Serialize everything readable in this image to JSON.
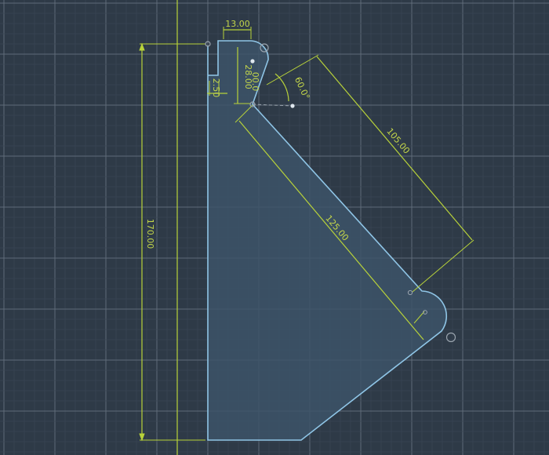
{
  "colors": {
    "background": "#2e3a47",
    "grid_minor": "#3a4654",
    "grid_major": "#5f6b78",
    "sketch_line": "#8fc5e6",
    "sketch_fill": "#3c5468",
    "dimension": "#b8d23a",
    "dimension_text": "#c4d64a",
    "construction": "#9aa4ae",
    "point": "#dfe7ee"
  },
  "dimensions": {
    "top_width": "13.00",
    "inner_depth": "28.00",
    "hole_offset": "00.0",
    "slot_width": "2.50",
    "angle": "60.0°",
    "diagonal_outer": "105.00",
    "diagonal_edge": "125.00",
    "total_height": "170.00"
  }
}
